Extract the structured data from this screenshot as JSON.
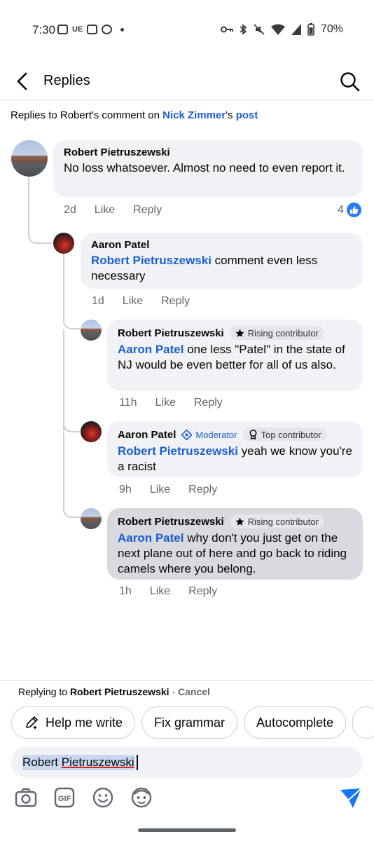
{
  "status_bar": {
    "time": "7:30",
    "left_icons": [
      "photo-icon",
      "ue-icon",
      "contacts-icon",
      "message-icon",
      "dot-icon"
    ],
    "ue_label": "UE",
    "battery": "70%",
    "right_icons": [
      "key-icon",
      "bluetooth-icon",
      "mute-icon",
      "wifi-icon",
      "signal-icon",
      "battery-icon"
    ]
  },
  "header": {
    "title": "Replies",
    "back_icon": "back-arrow-icon",
    "search_icon": "search-icon"
  },
  "context": {
    "prefix": "Replies to Robert's comment on ",
    "page_name": "Nick Zimmer",
    "possessive": "'s ",
    "post_link": "post"
  },
  "comments": [
    {
      "author": "Robert Pietruszewski",
      "text": "No loss whatsoever.  Almost no need to even report it.",
      "time": "2d",
      "like": "Like",
      "reply": "Reply",
      "reaction_count": "4"
    },
    {
      "author": "Aaron Patel",
      "mention": "Robert Pietruszewski",
      "text": " comment even less necessary",
      "time": "1d",
      "like": "Like",
      "reply": "Reply"
    },
    {
      "author": "Robert Pietruszewski",
      "badge": "Rising contributor",
      "mention": "Aaron Patel",
      "text": " one less \"Patel\" in the state of NJ would be even better for all of us also.",
      "time": "11h",
      "like": "Like",
      "reply": "Reply"
    },
    {
      "author": "Aaron Patel",
      "badge_mod": "Moderator",
      "badge": "Top contributor",
      "mention": "Robert Pietruszewski",
      "text": " yeah we know you're a racist",
      "time": "9h",
      "like": "Like",
      "reply": "Reply"
    },
    {
      "author": "Robert Pietruszewski",
      "badge": "Rising contributor",
      "mention": "Aaron Patel",
      "text": " why don't you just get on the next plane out of here and go back to riding camels where you belong.",
      "time": "1h",
      "like": "Like",
      "reply": "Reply"
    }
  ],
  "composer": {
    "replying_prefix": "Replying to ",
    "replying_name": "Robert Pietruszewski",
    "separator": " · ",
    "cancel": "Cancel",
    "chips": [
      "Help me write",
      "Fix grammar",
      "Autocomplete"
    ],
    "input_first": "Robert ",
    "input_second": "Pietruszewski",
    "tools": [
      "camera-icon",
      "gif-icon",
      "emoji-icon",
      "avatar-sticker-icon"
    ],
    "gif_label": "GIF",
    "send_icon": "send-icon"
  },
  "colors": {
    "link": "#1b5fd0",
    "bubble": "#f0f2f5",
    "highlight_bubble": "#d8dadf",
    "secondary_text": "#65676b",
    "like_blue": "#2b7cf6"
  }
}
